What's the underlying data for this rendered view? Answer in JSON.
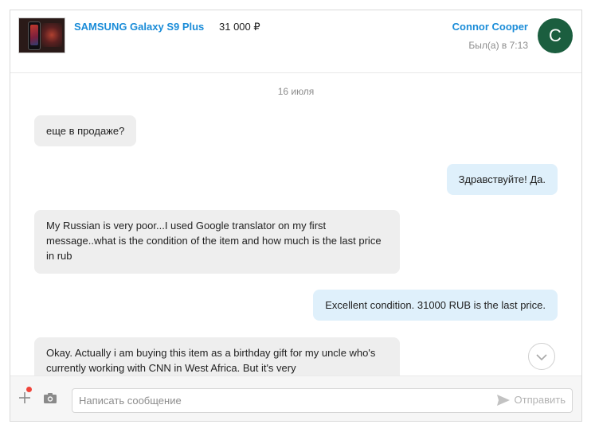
{
  "header": {
    "product_title": "SAMSUNG Galaxy S9 Plus",
    "product_price": "31 000 ₽",
    "user_name": "Connor Cooper",
    "last_seen": "Был(а) в 7:13",
    "avatar_letter": "C",
    "avatar_color": "#1b5e3f"
  },
  "chat": {
    "date_separator": "16 июля",
    "messages": [
      {
        "direction": "incoming",
        "text": "еще в продаже?"
      },
      {
        "direction": "outgoing",
        "text": "Здравствуйте! Да."
      },
      {
        "direction": "incoming",
        "text": "My Russian is very poor...I used Google translator on my first message..what is the condition of the item and how much is the last price in rub"
      },
      {
        "direction": "outgoing",
        "text": "Excellent condition. 31000 RUB is the last price."
      },
      {
        "direction": "incoming",
        "text": "Okay. Actually i am buying this item as a birthday gift for my uncle who's currently working with CNN in West Africa. But it's very"
      }
    ],
    "scroll_down_icon": "chevron-down-icon"
  },
  "composer": {
    "placeholder": "Написать сообщение",
    "send_label": "Отправить",
    "icons": [
      "plus-icon",
      "camera-icon",
      "send-icon"
    ]
  },
  "colors": {
    "link": "#1a8cd8",
    "incoming_bubble": "#eeeeee",
    "outgoing_bubble": "#dff0fb",
    "notification_dot": "#f0443a"
  }
}
